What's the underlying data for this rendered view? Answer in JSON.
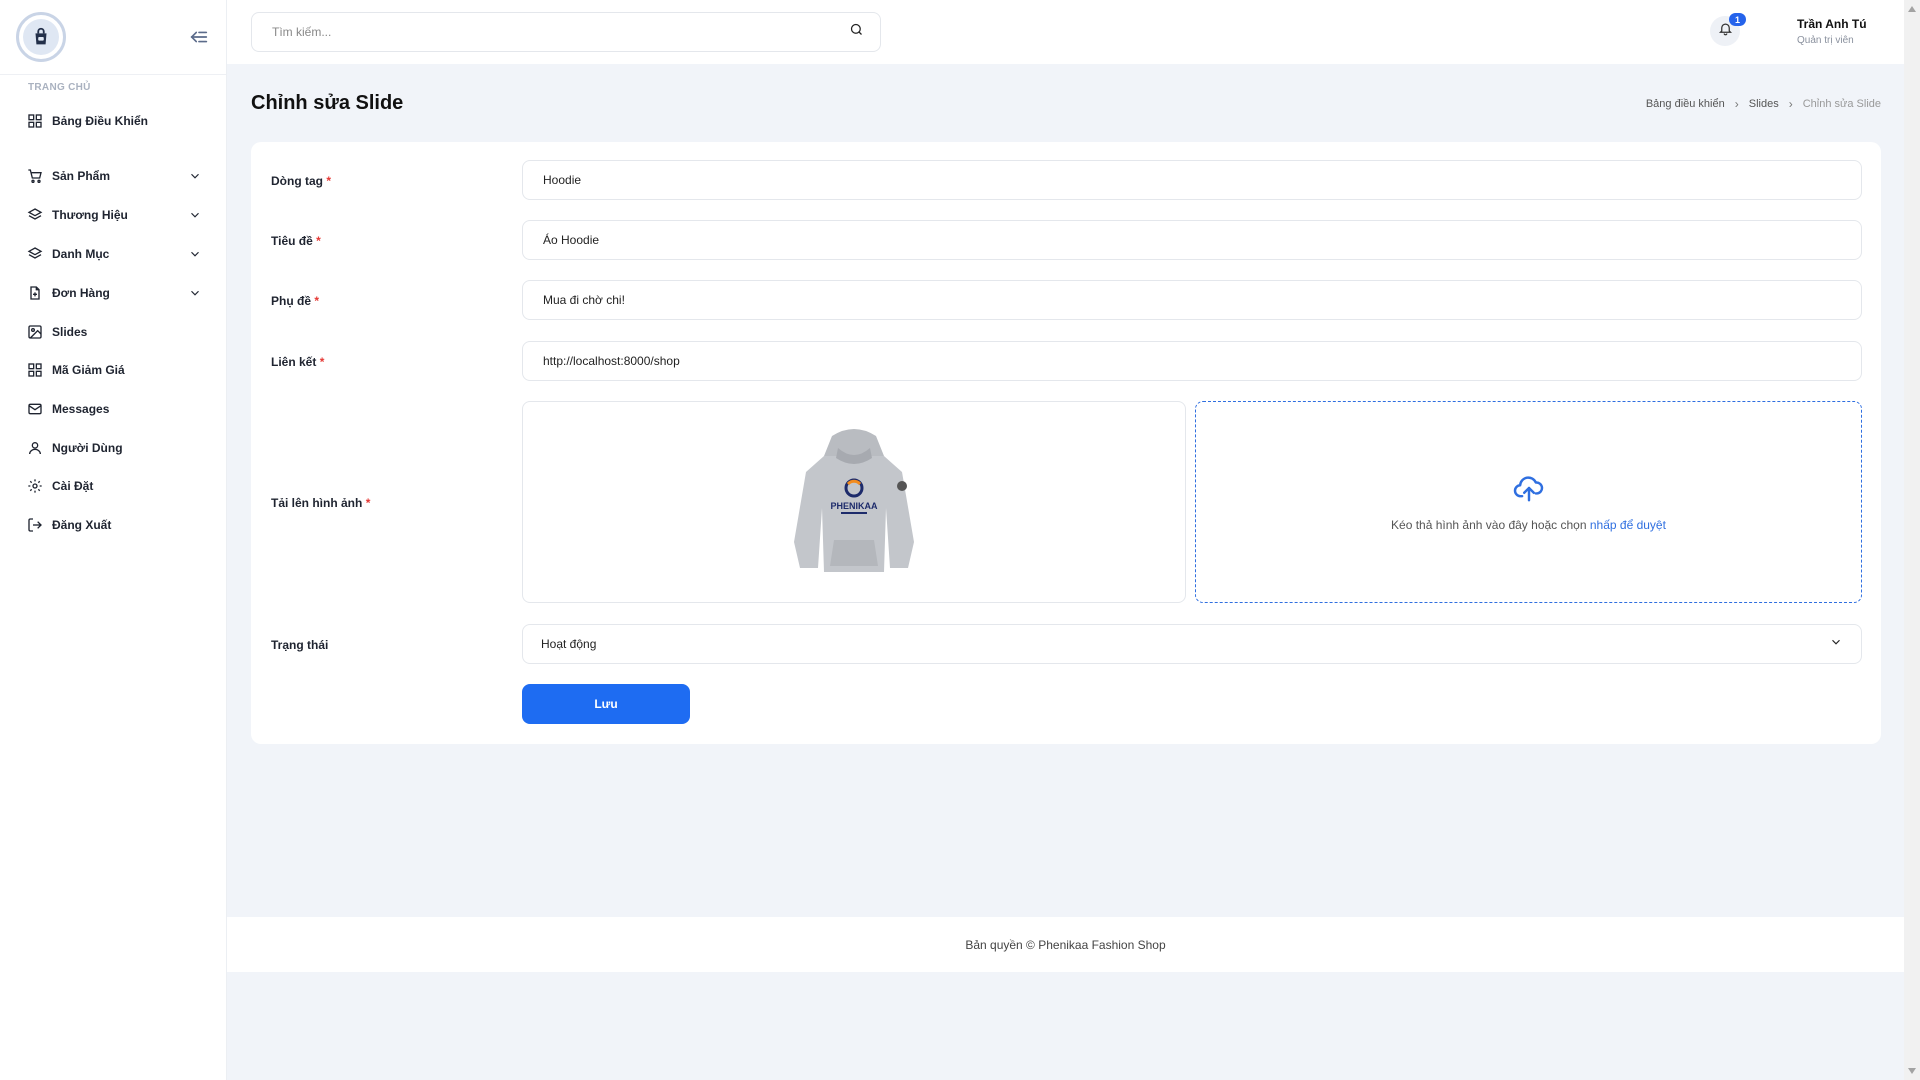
{
  "sidebar": {
    "section_title": "TRANG CHỦ",
    "items": [
      {
        "label": "Bảng Điều Khiển",
        "icon": "grid-icon"
      },
      {
        "label": "Sản Phẩm",
        "icon": "cart-icon",
        "expandable": true
      },
      {
        "label": "Thương Hiệu",
        "icon": "layers-icon",
        "expandable": true
      },
      {
        "label": "Danh Mục",
        "icon": "layers-icon",
        "expandable": true
      },
      {
        "label": "Đơn Hàng",
        "icon": "file-plus-icon",
        "expandable": true
      },
      {
        "label": "Slides",
        "icon": "image-icon"
      },
      {
        "label": "Mã Giảm Giá",
        "icon": "grid-icon"
      },
      {
        "label": "Messages",
        "icon": "mail-icon"
      },
      {
        "label": "Người Dùng",
        "icon": "user-icon"
      },
      {
        "label": "Cài Đặt",
        "icon": "gear-icon"
      },
      {
        "label": "Đăng Xuất",
        "icon": "logout-icon"
      }
    ]
  },
  "header": {
    "search_placeholder": "Tìm kiếm...",
    "notification_count": "1",
    "user_name": "Trần Anh Tú",
    "user_role": "Quản trị viên"
  },
  "page": {
    "title": "Chỉnh sửa Slide",
    "breadcrumb": [
      "Bảng điều khiển",
      "Slides",
      "Chỉnh sửa Slide"
    ]
  },
  "form": {
    "tag_label": "Dòng tag",
    "tag_value": "Hoodie",
    "title_label": "Tiêu đề",
    "title_value": "Áo Hoodie",
    "subtitle_label": "Phụ đề",
    "subtitle_value": "Mua đi chờ chi!",
    "link_label": "Liên kết",
    "link_value": "http://localhost:8000/shop",
    "image_label": "Tải lên hình ảnh",
    "image_alt": "PHENIKAA",
    "dropzone_text": "Kéo thả hình ảnh vào đây hoặc chọn",
    "dropzone_link": "nhấp để duyệt",
    "status_label": "Trạng thái",
    "status_value": "Hoạt động",
    "required_mark": "*",
    "save_label": "Lưu"
  },
  "footer": {
    "text": "Bản quyền © Phenikaa Fashion Shop"
  },
  "colors": {
    "accent": "#1e6cf2",
    "required": "#e53935",
    "background": "#f1f4f9"
  }
}
